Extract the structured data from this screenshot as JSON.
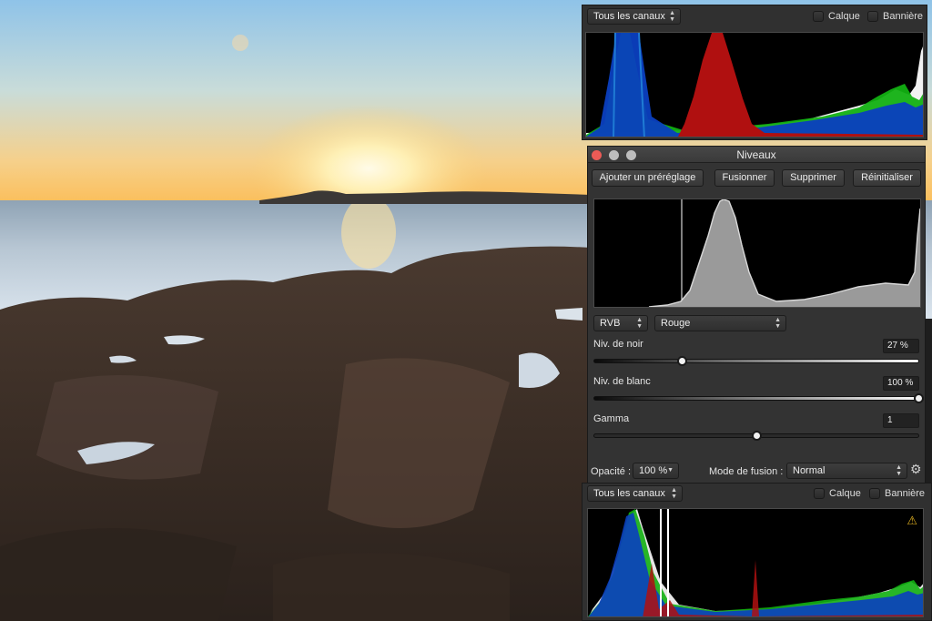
{
  "top_panel": {
    "channel_select": "Tous les canaux",
    "calque_label": "Calque",
    "banniere_label": "Bannière"
  },
  "levels_dialog": {
    "title": "Niveaux",
    "buttons": {
      "add_preset": "Ajouter un préréglage",
      "merge": "Fusionner",
      "delete": "Supprimer",
      "reset": "Réinitialiser"
    },
    "color_model_select": "RVB",
    "channel_select": "Rouge",
    "black_level": {
      "label": "Niv. de noir",
      "value": "27 %",
      "fraction": 0.27
    },
    "white_level": {
      "label": "Niv. de blanc",
      "value": "100 %",
      "fraction": 1.0
    },
    "gamma": {
      "label": "Gamma",
      "value": "1",
      "fraction": 0.5
    },
    "opacity_label": "Opacité :",
    "opacity_value": "100 %",
    "blend_mode_label": "Mode de fusion :",
    "blend_mode_value": "Normal"
  },
  "bottom_panel": {
    "channel_select": "Tous les canaux",
    "calque_label": "Calque",
    "banniere_label": "Bannière"
  },
  "colors": {
    "red_channel": "#b01010",
    "green_channel": "#12b012",
    "blue_channel": "#0b3fc0",
    "close_light": "#ec5b56",
    "disabled_light": "#bdbdbd"
  }
}
